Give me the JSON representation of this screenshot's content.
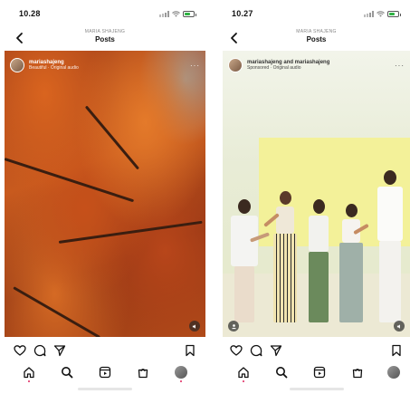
{
  "screens": [
    {
      "status": {
        "time": "10.28"
      },
      "header": {
        "username_small": "MARIA SHAJENG",
        "title": "Posts"
      },
      "post": {
        "username": "mariashajeng",
        "audio": "Beautiful · Original audio"
      }
    },
    {
      "status": {
        "time": "10.27"
      },
      "header": {
        "username_small": "MARIA SHAJENG",
        "title": "Posts"
      },
      "post": {
        "username": "mariashajeng and mariashajeng",
        "audio": "Sponsored · Original audio"
      }
    }
  ],
  "colors": {
    "like_dot": "#e0245e",
    "autumn": "#c85a1e",
    "studio_wall": "#f3f199"
  },
  "icons": {
    "back": "chevron-left-icon",
    "like": "heart-icon",
    "comment": "comment-icon",
    "share": "send-icon",
    "save": "bookmark-icon",
    "home": "home-icon",
    "search": "search-icon",
    "reels": "reels-icon",
    "shop": "shop-icon",
    "profile": "avatar"
  }
}
